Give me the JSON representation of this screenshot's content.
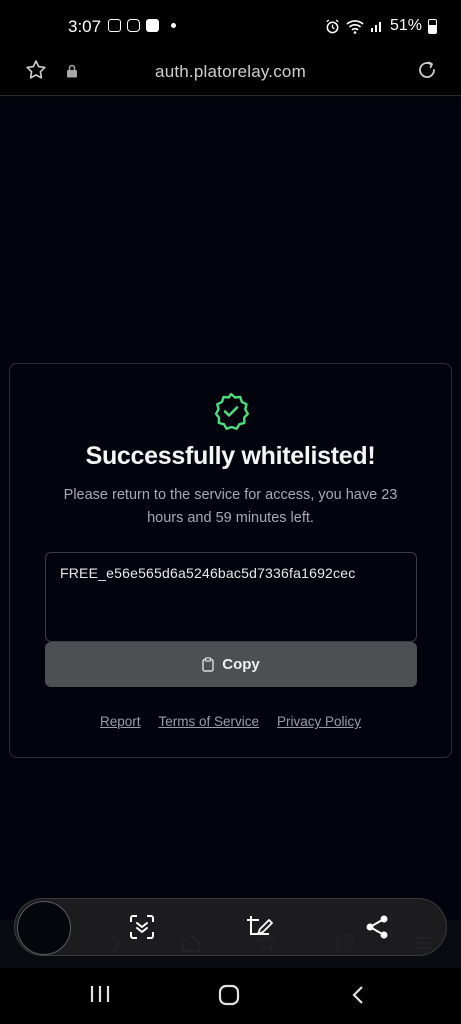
{
  "status_bar": {
    "time": "3:07",
    "battery": "51%",
    "icons": [
      "gallery-icon",
      "instagram-icon",
      "facebook-icon",
      "alarm-icon",
      "wifi-icon",
      "signal-icon",
      "battery-icon"
    ]
  },
  "browser": {
    "url": "auth.platorelay.com"
  },
  "card": {
    "title": "Successfully whitelisted!",
    "subtitle": "Please return to the service for access, you have 23 hours and 59 minutes left.",
    "key": "FREE_e56e565d6a5246bac5d7336fa1692cec",
    "copy_label": "Copy",
    "links": {
      "report": "Report",
      "terms": "Terms of Service",
      "privacy": "Privacy Policy"
    }
  },
  "colors": {
    "accent_green": "#4ade80",
    "page_bg": "#02040d",
    "button_bg": "#4e4f53"
  }
}
